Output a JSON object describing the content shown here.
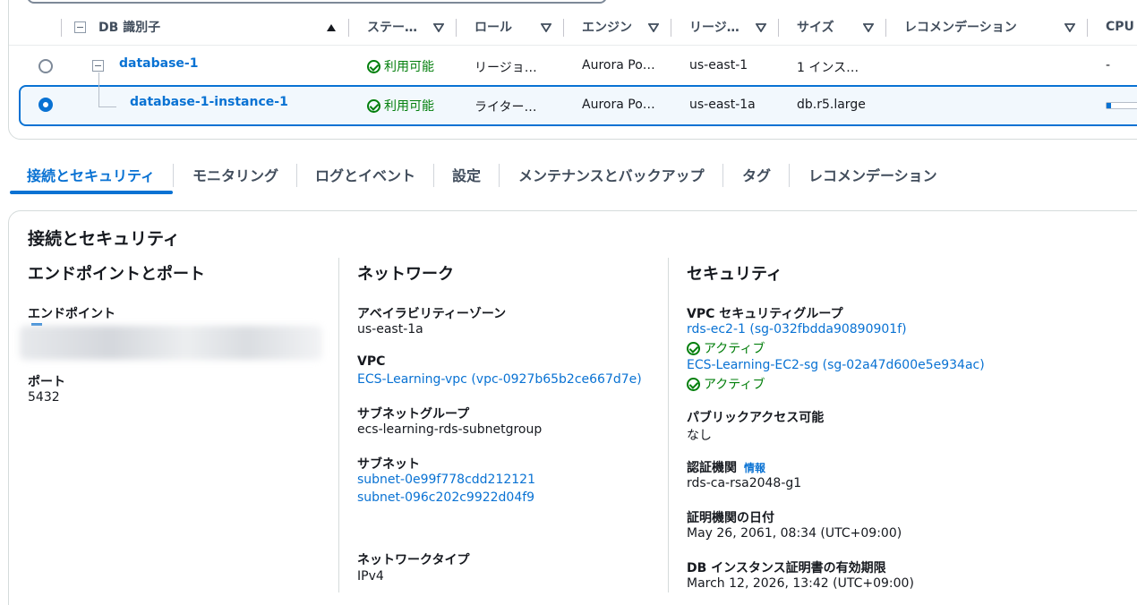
{
  "table": {
    "columns": [
      {
        "label": "DB 識別子"
      },
      {
        "label": "ステー…"
      },
      {
        "label": "ロール"
      },
      {
        "label": "エンジン"
      },
      {
        "label": "リージ…"
      },
      {
        "label": "サイズ"
      },
      {
        "label": "レコメンデーション"
      },
      {
        "label": "CPU"
      }
    ],
    "rows": [
      {
        "identifier": "database-1",
        "status": "利用可能",
        "role": "リージョ…",
        "engine": "Aurora Po…",
        "region": "us-east-1",
        "size": "1 インス…",
        "cpu": "-"
      },
      {
        "identifier": "database-1-instance-1",
        "status": "利用可能",
        "role": "ライター…",
        "engine": "Aurora Po…",
        "region": "us-east-1a",
        "size": "db.r5.large",
        "cpu_fill_percent": 8
      }
    ],
    "selected_row": 1,
    "status_color": "#037f0c",
    "accent_color": "#0972d3"
  },
  "tabs": [
    {
      "label": "接続とセキュリティ",
      "active": true
    },
    {
      "label": "モニタリング"
    },
    {
      "label": "ログとイベント"
    },
    {
      "label": "設定"
    },
    {
      "label": "メンテナンスとバックアップ"
    },
    {
      "label": "タグ"
    },
    {
      "label": "レコメンデーション"
    }
  ],
  "detail": {
    "title": "接続とセキュリティ",
    "endpoint_section": {
      "title": "エンドポイントとポート",
      "endpoint_label": "エンドポイント",
      "port_label": "ポート",
      "port_value": "5432"
    },
    "network_section": {
      "title": "ネットワーク",
      "az_label": "アベイラビリティーゾーン",
      "az_value": "us-east-1a",
      "vpc_label": "VPC",
      "vpc_value": "ECS-Learning-vpc (vpc-0927b65b2ce667d7e)",
      "subnet_group_label": "サブネットグループ",
      "subnet_group_value": "ecs-learning-rds-subnetgroup",
      "subnets_label": "サブネット",
      "subnets": [
        "subnet-0e99f778cdd212121",
        "subnet-096c202c9922d04f9"
      ],
      "network_type_label": "ネットワークタイプ",
      "network_type_value": "IPv4"
    },
    "security_section": {
      "title": "セキュリティ",
      "sg_label": "VPC セキュリティグループ",
      "security_groups": [
        {
          "name": "rds-ec2-1 (sg-032fbdda90890901f)",
          "status": "アクティブ"
        },
        {
          "name": "ECS-Learning-EC2-sg (sg-02a47d600e5e934ac)",
          "status": "アクティブ"
        }
      ],
      "public_label": "パブリックアクセス可能",
      "public_value": "なし",
      "ca_label": "認証機関",
      "ca_info": "情報",
      "ca_value": "rds-ca-rsa2048-g1",
      "ca_date_label": "証明機関の日付",
      "ca_date_value": "May 26, 2061, 08:34 (UTC+09:00)",
      "cert_expiry_label": "DB インスタンス証明書の有効期限",
      "cert_expiry_value": "March 12, 2026, 13:42 (UTC+09:00)"
    }
  }
}
